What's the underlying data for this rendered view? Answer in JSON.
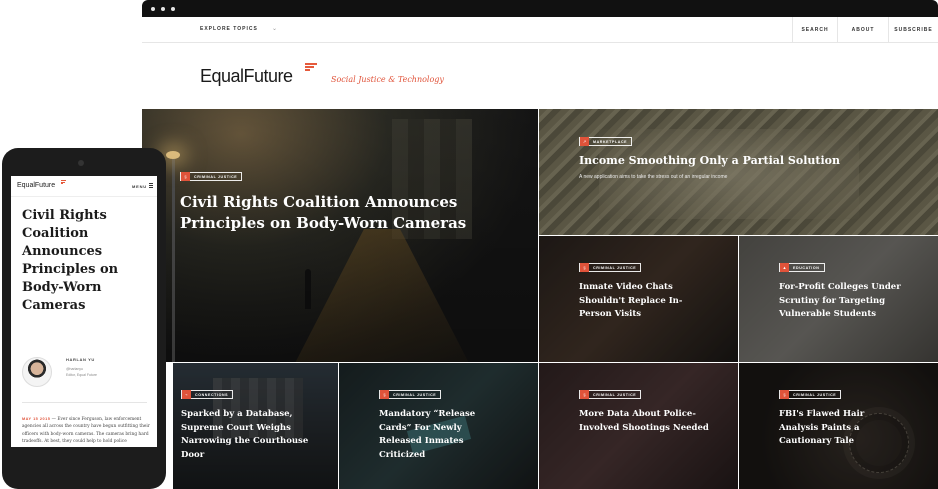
{
  "desktop": {
    "nav": {
      "explore": "EXPLORE TOPICS",
      "explore_chevron": "⌄",
      "search": "SEARCH",
      "about": "ABOUT",
      "subscribe": "SUBSCRIBE"
    },
    "logo": "EqualFuture",
    "tagline": "Social Justice & Technology",
    "accent_color": "#e0533a",
    "featured": {
      "tag": "CRIMINAL JUSTICE",
      "tag_icon": "gavel-icon",
      "headline": "Civil Rights Coalition Announces Principles on Body-Worn Cameras"
    },
    "marketplace": {
      "tag": "MARKETPLACE",
      "tag_icon": "chart-icon",
      "headline": "Income Smoothing Only a Partial Solution",
      "subtitle": "A new application aims to take the stress out of an irregular income"
    },
    "row2": [
      {
        "tag": "CRIMINAL JUSTICE",
        "headline": "Inmate Video Chats Shouldn't Replace In-Person Visits"
      },
      {
        "tag": "EDUCATION",
        "headline": "For-Profit Colleges Under Scrutiny for Targeting Vulnerable Students"
      }
    ],
    "row3": [
      {
        "tag": "CONNECTIONS",
        "headline": "Sparked by a Database, Supreme Court Weighs Narrowing the Courthouse Door"
      },
      {
        "tag": "CRIMINAL JUSTICE",
        "headline": "Mandatory “Release Cards” For Newly Released Inmates Criticized"
      },
      {
        "tag": "CRIMINAL JUSTICE",
        "headline": "More Data About Police-Involved Shootings Needed"
      },
      {
        "tag": "CRIMINAL JUSTICE",
        "headline": "FBI's Flawed Hair Analysis Paints a Cautionary Tale"
      }
    ]
  },
  "mobile": {
    "logo": "EqualFuture",
    "menu": "MENU",
    "headline": "Civil Rights Coalition Announces Principles on Body-Worn Cameras",
    "author": {
      "name": "HARLAN YU",
      "handle": "@harlanyu",
      "role": "Editor, Equal Future"
    },
    "date": "MAY 15 2015",
    "body": "Ever since Ferguson, law enforcement agencies all across the country have begun outfitting their officers with body-worn cameras. The cameras bring hard tradeoffs. At best, they could help to hold police accountable, but they also risk intensifying surveillance, reducing"
  }
}
